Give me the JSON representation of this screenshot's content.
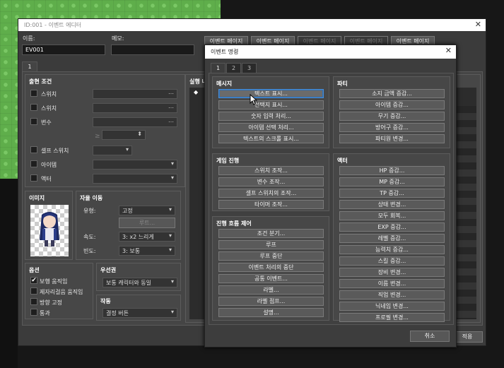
{
  "editor": {
    "title": "ID:001 - 이벤트 에디터",
    "name_label": "이름:",
    "name_value": "EV001",
    "memo_label": "메모:",
    "memo_value": "",
    "page_buttons": [
      "이벤트 페이지",
      "이벤트 페이지",
      "이벤트 페이지",
      "이벤트 페이지",
      "이벤트 페이지"
    ],
    "page_tab": "1",
    "conditions": {
      "title": "출현 조건",
      "items": [
        "스위치",
        "스위치",
        "변수",
        "셀프 스위치",
        "아이템",
        "액터"
      ]
    },
    "image_title": "이미지",
    "move": {
      "title": "자율 이동",
      "type_label": "유형:",
      "type_value": "고정",
      "route_button": "루트...",
      "speed_label": "속도:",
      "speed_value": "3: x2 느리게",
      "freq_label": "빈도:",
      "freq_value": "3: 보통"
    },
    "options": {
      "title": "옵션",
      "items": [
        "보행 움직임",
        "제자리걸음 움직임",
        "방향 고정",
        "통과"
      ],
      "checked": [
        true,
        false,
        false,
        false
      ]
    },
    "priority": {
      "title": "우선권",
      "value": "보통 캐릭터와 동일"
    },
    "trigger": {
      "title": "작동",
      "value": "결정 버튼"
    },
    "contents_title": "실행 내",
    "apply_button": "적용"
  },
  "dialog": {
    "title": "이벤트 명령",
    "tabs": [
      "1",
      "2",
      "3"
    ],
    "message": {
      "title": "메시지",
      "commands": [
        "텍스트 표시...",
        "선택지 표시...",
        "숫자 입력 처리...",
        "아이템 선택 처리...",
        "텍스트의 스크롤 표시..."
      ]
    },
    "game_progress": {
      "title": "게임 진행",
      "commands": [
        "스위치 조작...",
        "변수 조작...",
        "셀프 스위치의 조작...",
        "타이머 조작..."
      ]
    },
    "flow": {
      "title": "진행 흐름 제어",
      "commands": [
        "조건 분기...",
        "루프",
        "루프 중단",
        "이벤트 처리의 중단",
        "공통 이벤트...",
        "라벨...",
        "라벨 점프...",
        "설명..."
      ]
    },
    "party": {
      "title": "파티",
      "commands": [
        "소지 금액 증감...",
        "아이템 증감...",
        "무기 증감...",
        "방어구 증감...",
        "파티원 변경..."
      ]
    },
    "actor": {
      "title": "액터",
      "commands": [
        "HP 증감...",
        "MP 증감...",
        "TP 증감...",
        "상태 변경...",
        "모두 회복...",
        "EXP 증감...",
        "레벨 증감...",
        "능력치 증감...",
        "스킬 증감...",
        "장비 변경...",
        "이름 변경...",
        "직업 변경...",
        "닉네임 변경...",
        "프로필 변경..."
      ]
    },
    "cancel_button": "취소"
  }
}
